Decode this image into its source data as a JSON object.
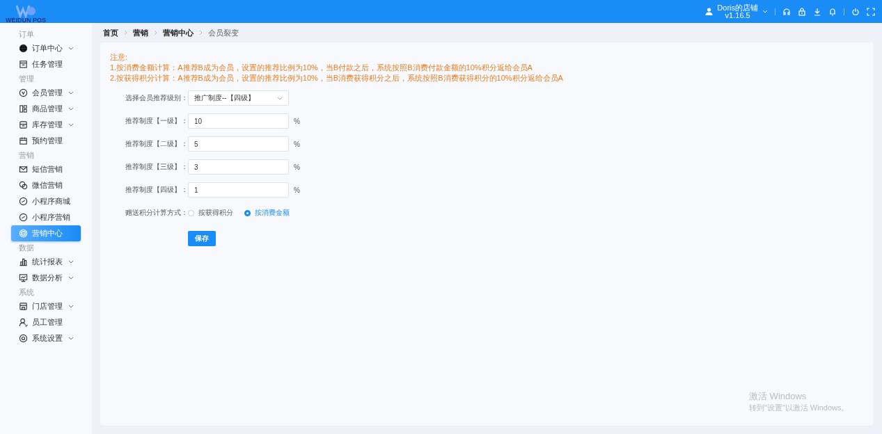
{
  "header": {
    "logo_text": "WEIDUN POS",
    "store": "Doris的店铺",
    "version": "v1.16.5"
  },
  "sidebar": {
    "sections": [
      {
        "title": "订单",
        "items": [
          {
            "label": "订单中心",
            "expandable": true,
            "selected": false
          },
          {
            "label": "任务管理",
            "expandable": false,
            "selected": false
          }
        ]
      },
      {
        "title": "管理",
        "items": [
          {
            "label": "会员管理",
            "expandable": true,
            "selected": false
          },
          {
            "label": "商品管理",
            "expandable": true,
            "selected": false
          },
          {
            "label": "库存管理",
            "expandable": true,
            "selected": false
          },
          {
            "label": "预约管理",
            "expandable": false,
            "selected": false
          }
        ]
      },
      {
        "title": "营销",
        "items": [
          {
            "label": "短信营销",
            "expandable": false,
            "selected": false
          },
          {
            "label": "微信营销",
            "expandable": false,
            "selected": false
          },
          {
            "label": "小程序商城",
            "expandable": false,
            "selected": false
          },
          {
            "label": "小程序营销",
            "expandable": false,
            "selected": false
          },
          {
            "label": "营销中心",
            "expandable": false,
            "selected": true
          }
        ]
      },
      {
        "title": "数据",
        "items": [
          {
            "label": "统计报表",
            "expandable": true,
            "selected": false
          },
          {
            "label": "数据分析",
            "expandable": true,
            "selected": false
          }
        ]
      },
      {
        "title": "系统",
        "items": [
          {
            "label": "门店管理",
            "expandable": true,
            "selected": false
          },
          {
            "label": "员工管理",
            "expandable": false,
            "selected": false
          },
          {
            "label": "系统设置",
            "expandable": true,
            "selected": false
          }
        ]
      }
    ]
  },
  "breadcrumb": [
    {
      "label": "首页",
      "current": false
    },
    {
      "label": "营销",
      "current": false
    },
    {
      "label": "营销中心",
      "current": false
    },
    {
      "label": "会员裂变",
      "current": true
    }
  ],
  "notice": {
    "title": "注意:",
    "lines": [
      "1.按消费金额计算：A推荐B成为会员，设置的推荐比例为10%，当B付款之后，系统按照B消费付款金额的10%积分返给会员A",
      "2.按获得积分计算：A推荐B成为会员，设置的推荐比例为10%，当B消费获得积分之后，系统按照B消费获得积分的10%积分返给会员A"
    ]
  },
  "form": {
    "fields": [
      {
        "kind": "select",
        "label": "选择会员推荐级别：",
        "value": "推广制度--【四级】"
      },
      {
        "kind": "input",
        "label": "推荐制度【一级】：",
        "value": "10",
        "unit": "%"
      },
      {
        "kind": "input",
        "label": "推荐制度【二级】：",
        "value": "5",
        "unit": "%"
      },
      {
        "kind": "input",
        "label": "推荐制度【三级】：",
        "value": "3",
        "unit": "%"
      },
      {
        "kind": "input",
        "label": "推荐制度【四级】：",
        "value": "1",
        "unit": "%"
      },
      {
        "kind": "radio",
        "label": "赠送积分计算方式：",
        "options": [
          {
            "label": "按获得积分",
            "selected": false
          },
          {
            "label": "按消费金额",
            "selected": true
          }
        ]
      }
    ],
    "save_button": "保存"
  },
  "os_overlay": {
    "title": "激活 Windows",
    "hint": "转到\"设置\"以激活 Windows。"
  }
}
